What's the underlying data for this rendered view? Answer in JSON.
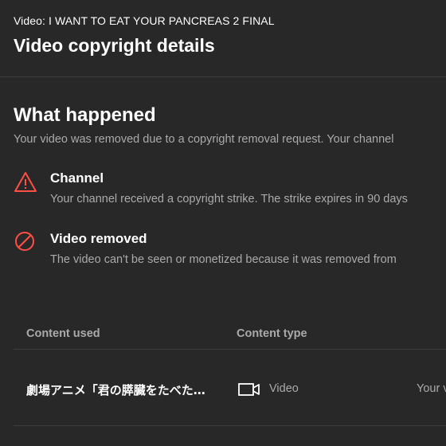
{
  "header": {
    "video_line": "Video: I WANT TO EAT YOUR PANCREAS 2 FINAL",
    "title": "Video copyright details"
  },
  "what_happened": {
    "heading": "What happened",
    "description": "Your video was removed due to a copyright removal request. Your channel",
    "events": [
      {
        "icon": "warning-triangle-icon",
        "title": "Channel",
        "description": "Your channel received a copyright strike. The strike expires in 90 days"
      },
      {
        "icon": "prohibited-circle-icon",
        "title": "Video removed",
        "description": "The video can't be seen or monetized because it was removed from"
      }
    ]
  },
  "table": {
    "columns": [
      "Content used",
      "Content type"
    ],
    "rows": [
      {
        "content_used": "劇場アニメ「君の膵臓をたべた…",
        "type_icon": "video-camera-icon",
        "content_type": "Video",
        "extra": "Your v"
      }
    ]
  },
  "colors": {
    "background": "#282828",
    "accent_red": "#ff4e45",
    "secondary_text": "#aaaaaa"
  }
}
